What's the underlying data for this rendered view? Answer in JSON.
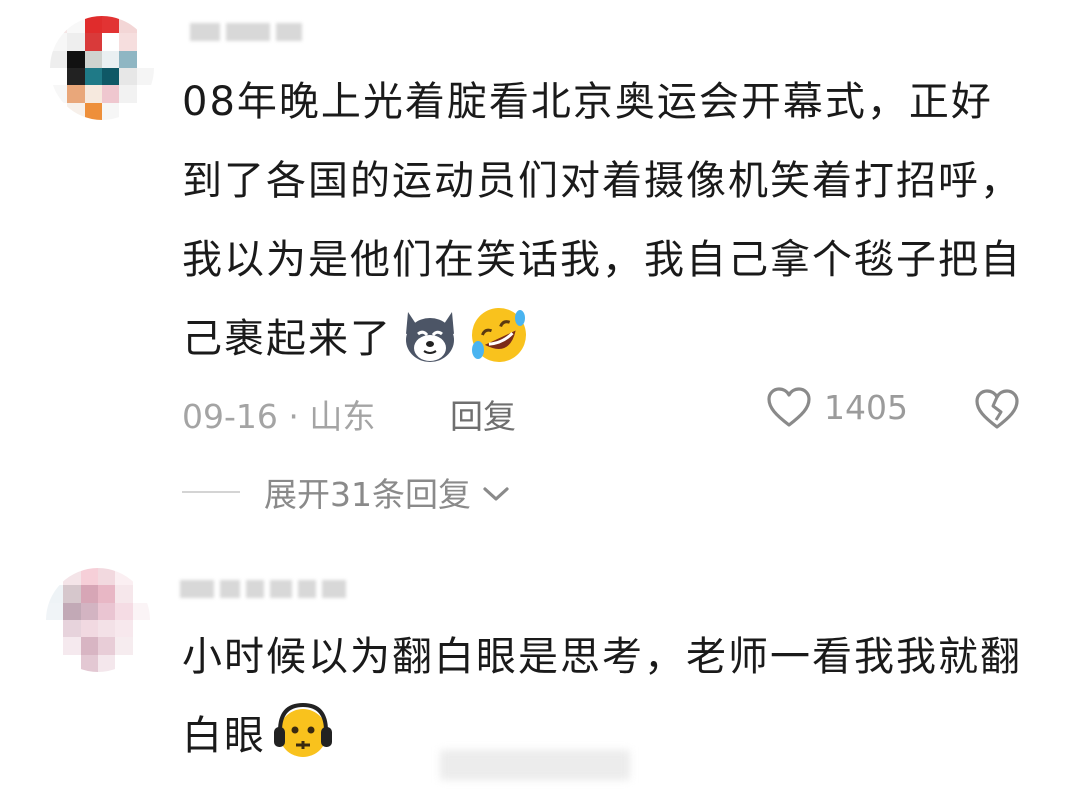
{
  "comments": [
    {
      "text": "08年晚上光着腚看北京奥运会开幕式，正好到了各国的运动员们对着摄像机笑着打招呼，我以为是他们在笑话我，我自己拿个毯子把自己裹起来了",
      "emojis": [
        "dog-face-emoji",
        "rolling-laughing-emoji"
      ],
      "date_location": "09-16 · 山东",
      "reply_label": "回复",
      "likes": "1405",
      "expand_label": "展开31条回复"
    },
    {
      "text": "小时候以为翻白眼是思考，老师一看我我就翻白眼",
      "emojis": [
        "headphones-face-emoji"
      ]
    }
  ],
  "colors": {
    "text": "#1a1a1a",
    "meta": "#a4a4a4",
    "reply": "#6f6f6f",
    "icon": "#8a8a8a"
  }
}
